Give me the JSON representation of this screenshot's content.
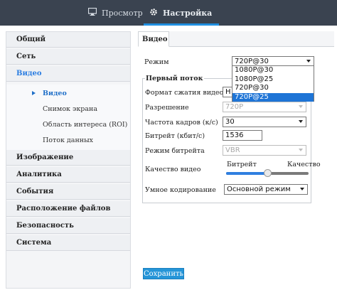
{
  "topbar": {
    "tabs": [
      {
        "label": "Просмотр",
        "icon": "monitor-icon"
      },
      {
        "label": "Настройка",
        "icon": "gear-icon"
      }
    ],
    "active_tab": "Настройка",
    "colors": {
      "bg": "#3a4350",
      "accent": "#1f8fe0"
    }
  },
  "sidebar": {
    "items": [
      {
        "label": "Общий"
      },
      {
        "label": "Сеть"
      },
      {
        "label": "Видео"
      },
      {
        "label": "Изображение"
      },
      {
        "label": "Аналитика"
      },
      {
        "label": "События"
      },
      {
        "label": "Расположение файлов"
      },
      {
        "label": "Безопасность"
      },
      {
        "label": "Система"
      }
    ],
    "active_item": "Видео",
    "video_subitems": [
      {
        "label": "Видео"
      },
      {
        "label": "Снимок экрана"
      },
      {
        "label": "Область интереса (ROI)"
      },
      {
        "label": "Поток данных"
      }
    ],
    "active_subitem": "Видео"
  },
  "content": {
    "tab_label": "Видео",
    "mode": {
      "label": "Режим",
      "value": "720P@30",
      "options": [
        "1080P@30",
        "1080P@25",
        "720P@30",
        "720P@25"
      ],
      "highlighted_option": "720P@25"
    },
    "first_stream": {
      "legend": "Первый поток",
      "compression": {
        "label": "Формат сжатия видео",
        "value": "H"
      },
      "resolution": {
        "label": "Разрешение",
        "value": "720P"
      },
      "framerate": {
        "label": "Частота кадров (к/с)",
        "value": "30"
      },
      "bitrate": {
        "label": "Битрейт (кбит/с)",
        "value": "1536"
      },
      "bitrate_mode": {
        "label": "Режим битрейта",
        "value": "VBR"
      },
      "quality": {
        "label": "Качество видео",
        "left_label": "Битрейт",
        "right_label": "Качество",
        "level": 0.5
      },
      "smart_coding": {
        "label": "Умное кодирование",
        "value": "Основной режим"
      }
    },
    "save_label": "Сохранить"
  }
}
